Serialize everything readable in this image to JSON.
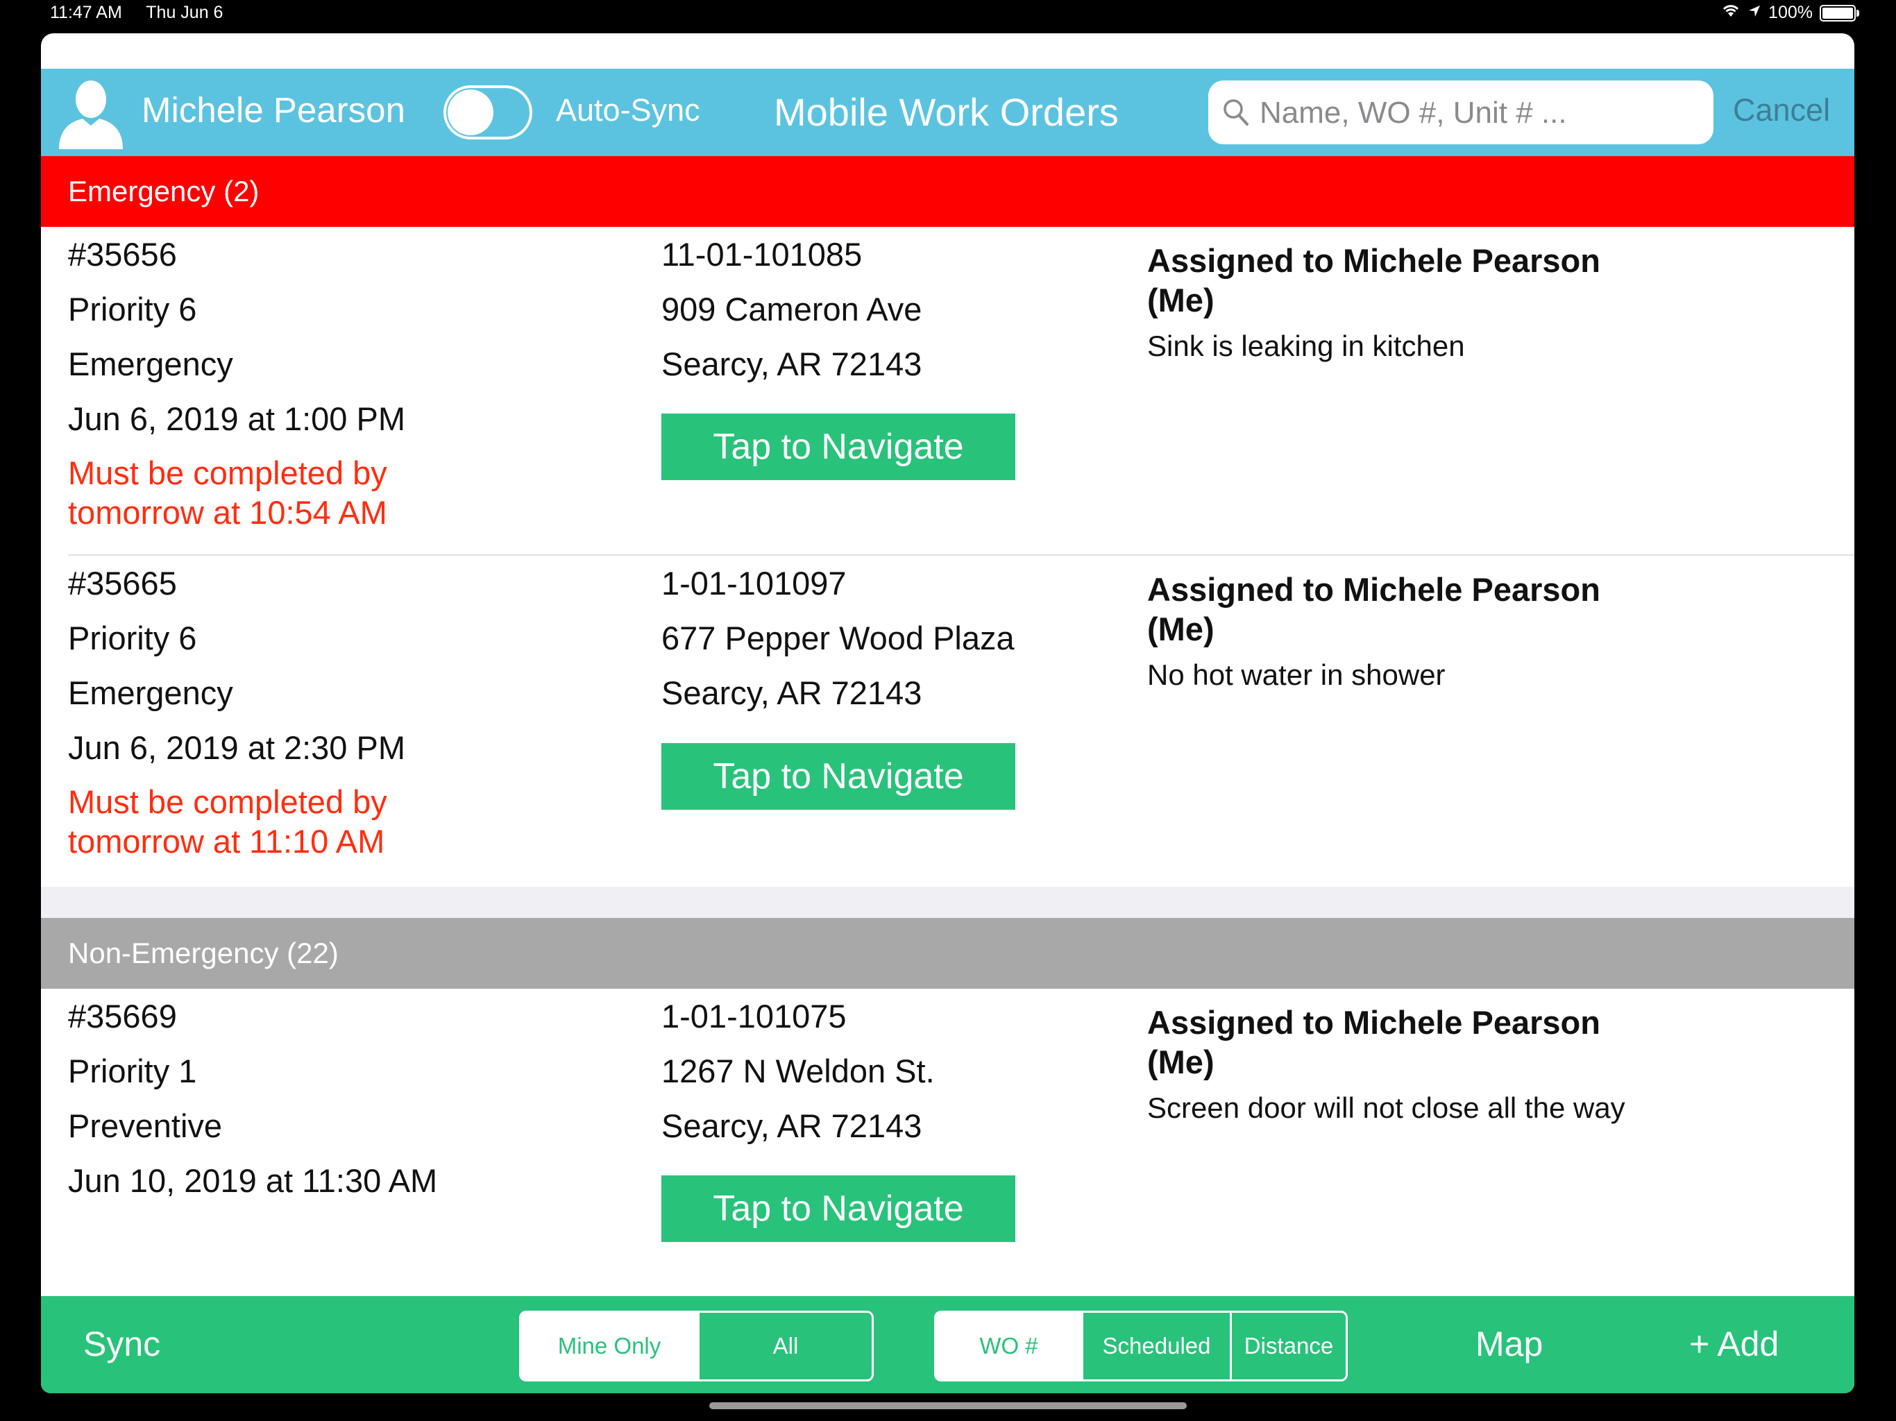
{
  "status_bar": {
    "time": "11:47 AM",
    "date": "Thu Jun 6",
    "battery": "100%",
    "battery_level": 1.0
  },
  "header": {
    "user_name": "Michele Pearson",
    "auto_sync_label": "Auto-Sync",
    "auto_sync_on": false,
    "title": "Mobile Work Orders",
    "search_placeholder": "Name, WO #, Unit # ...",
    "cancel_label": "Cancel",
    "accent_color": "#5bc3e0"
  },
  "sections": {
    "emergency": {
      "label": "Emergency (2)",
      "color": "#ff0000"
    },
    "non_emergency": {
      "label": "Non-Emergency (22)",
      "color": "#a8a8a8"
    }
  },
  "work_orders": [
    {
      "number": "#35656",
      "priority": "Priority 6",
      "type": "Emergency",
      "scheduled": "Jun 6, 2019 at 1:00 PM",
      "deadline": "Must be completed by tomorrow at 10:54 AM",
      "unit": "11-01-101085",
      "street": "909 Cameron Ave",
      "city": "Searcy, AR 72143",
      "navigate_label": "Tap to Navigate",
      "assigned": "Assigned to Michele Pearson (Me)",
      "description": "Sink is leaking in kitchen"
    },
    {
      "number": "#35665",
      "priority": "Priority 6",
      "type": "Emergency",
      "scheduled": "Jun 6, 2019 at 2:30 PM",
      "deadline": "Must be completed by tomorrow at 11:10 AM",
      "unit": "1-01-101097",
      "street": "677 Pepper Wood Plaza",
      "city": "Searcy, AR 72143",
      "navigate_label": "Tap to Navigate",
      "assigned": "Assigned to Michele Pearson (Me)",
      "description": "No hot water in shower"
    },
    {
      "number": "#35669",
      "priority": "Priority 1",
      "type": "Preventive",
      "scheduled": "Jun 10, 2019 at 11:30 AM",
      "unit": "1-01-101075",
      "street": "1267 N Weldon St.",
      "city": "Searcy, AR 72143",
      "navigate_label": "Tap to Navigate",
      "assigned": "Assigned to Michele Pearson (Me)",
      "description": "Screen door will not close all the way"
    }
  ],
  "toolbar": {
    "sync_label": "Sync",
    "filter": {
      "options": [
        "Mine Only",
        "All"
      ],
      "selected": "Mine Only"
    },
    "sort": {
      "options": [
        "WO #",
        "Scheduled",
        "Distance"
      ],
      "selected": "WO #"
    },
    "map_label": "Map",
    "add_label": "+ Add",
    "color": "#28c27a"
  }
}
